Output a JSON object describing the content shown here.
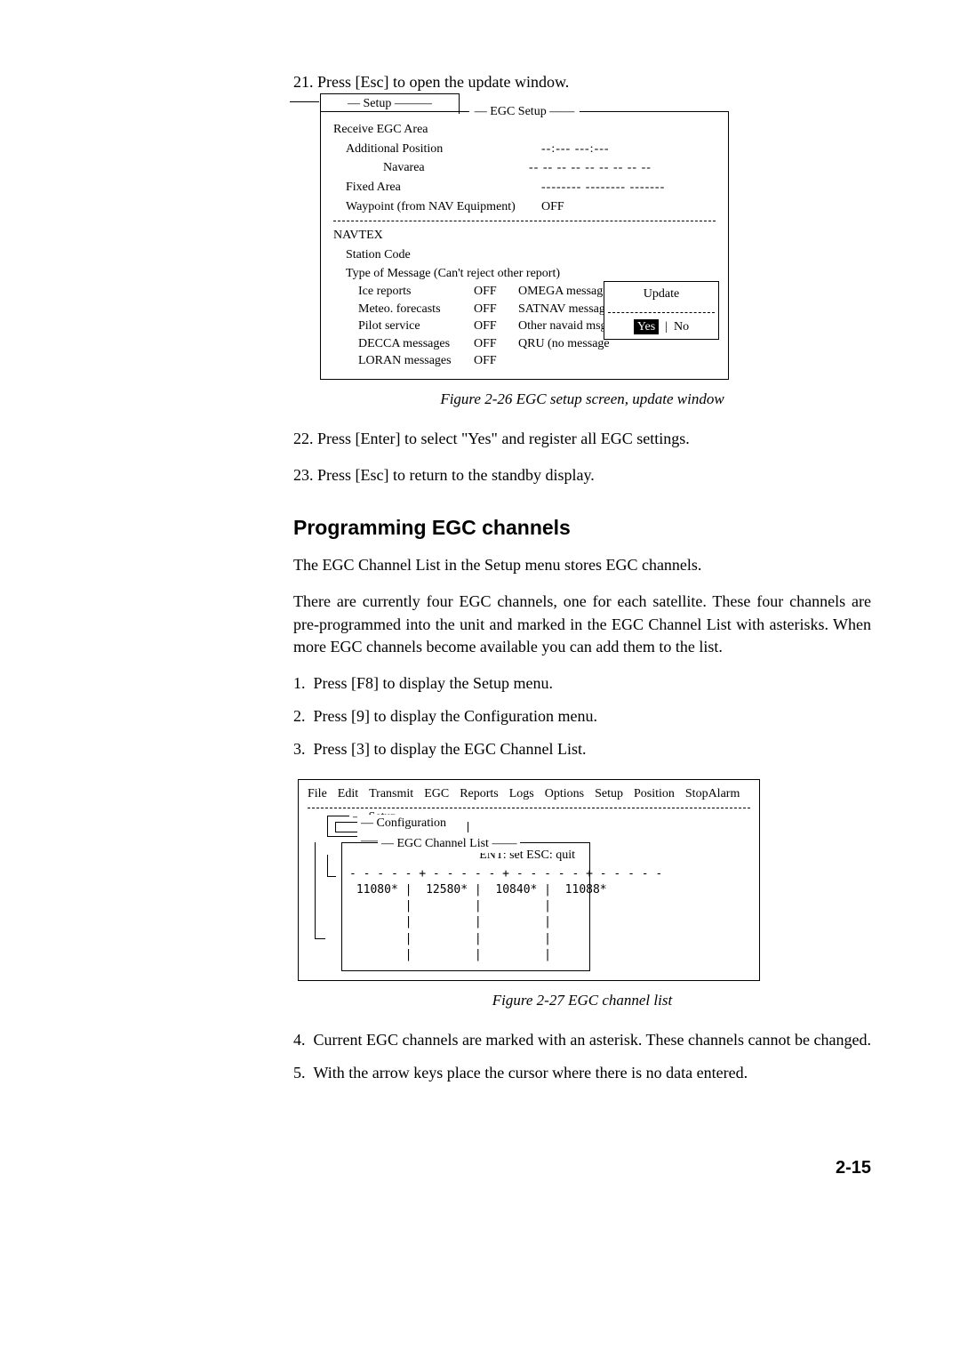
{
  "step21": "21. Press [Esc] to open the update window.",
  "figure1": {
    "tab": "Setup",
    "title": "EGC Setup",
    "receiveArea": "Receive EGC Area",
    "addlPosition": "Additional Position",
    "addlPositionVal": "--:--- ---:---",
    "navarea": "Navarea",
    "navareaVal": "-- -- -- -- -- -- -- -- --",
    "fixedArea": "Fixed Area",
    "fixedAreaVal": "-------- -------- -------",
    "waypoint": "Waypoint (from NAV Equipment)",
    "waypointVal": "OFF",
    "navtex": "NAVTEX",
    "stationCode": "Station Code",
    "typeMsg": "Type of Message (Can't reject other report)",
    "rows": [
      {
        "l": "Ice reports",
        "v": "OFF",
        "r": "OMEGA messag"
      },
      {
        "l": "Meteo. forecasts",
        "v": "OFF",
        "r": "SATNAV messag"
      },
      {
        "l": "Pilot service",
        "v": "OFF",
        "r": "Other navaid msg"
      },
      {
        "l": "DECCA messages",
        "v": "OFF",
        "r": "QRU (no message"
      },
      {
        "l": "LORAN messages",
        "v": "OFF",
        "r": ""
      }
    ],
    "updateTitle": "Update",
    "yes": "Yes",
    "no": "No",
    "caption": "Figure 2-26 EGC setup screen, update window"
  },
  "step22": "22. Press [Enter] to select \"Yes\" and register all EGC settings.",
  "step23": "23. Press [Esc] to return to the standby display.",
  "heading": "Programming EGC channels",
  "para1": "The EGC Channel List in the Setup menu stores EGC channels.",
  "para2": "There are currently four EGC channels, one for each satellite. These four channels are pre-programmed into the unit and marked in the EGC Channel List with asterisks. When more EGC channels become available you can add them to the list.",
  "numbered": [
    "Press [F8] to display the Setup menu.",
    "Press [9] to display the Configuration menu.",
    "Press [3] to display the EGC Channel List."
  ],
  "figure2": {
    "menu": [
      "File",
      "Edit",
      "Transmit",
      "EGC",
      "Reports",
      "Logs",
      "Options",
      "Setup",
      "Position",
      "StopAlarm"
    ],
    "setup": "Setup",
    "config": "Configuration",
    "chanList": "EGC Channel List",
    "hint": "ENT: set  ESC: quit",
    "channels": [
      "11080*",
      "12580*",
      "10840*",
      "11088*"
    ],
    "caption": "Figure 2-27 EGC channel list"
  },
  "step4": "Current EGC channels are marked with an asterisk. These channels cannot be changed.",
  "step5": "With the arrow keys place the cursor where there is no data entered.",
  "pageNum": "2-15"
}
